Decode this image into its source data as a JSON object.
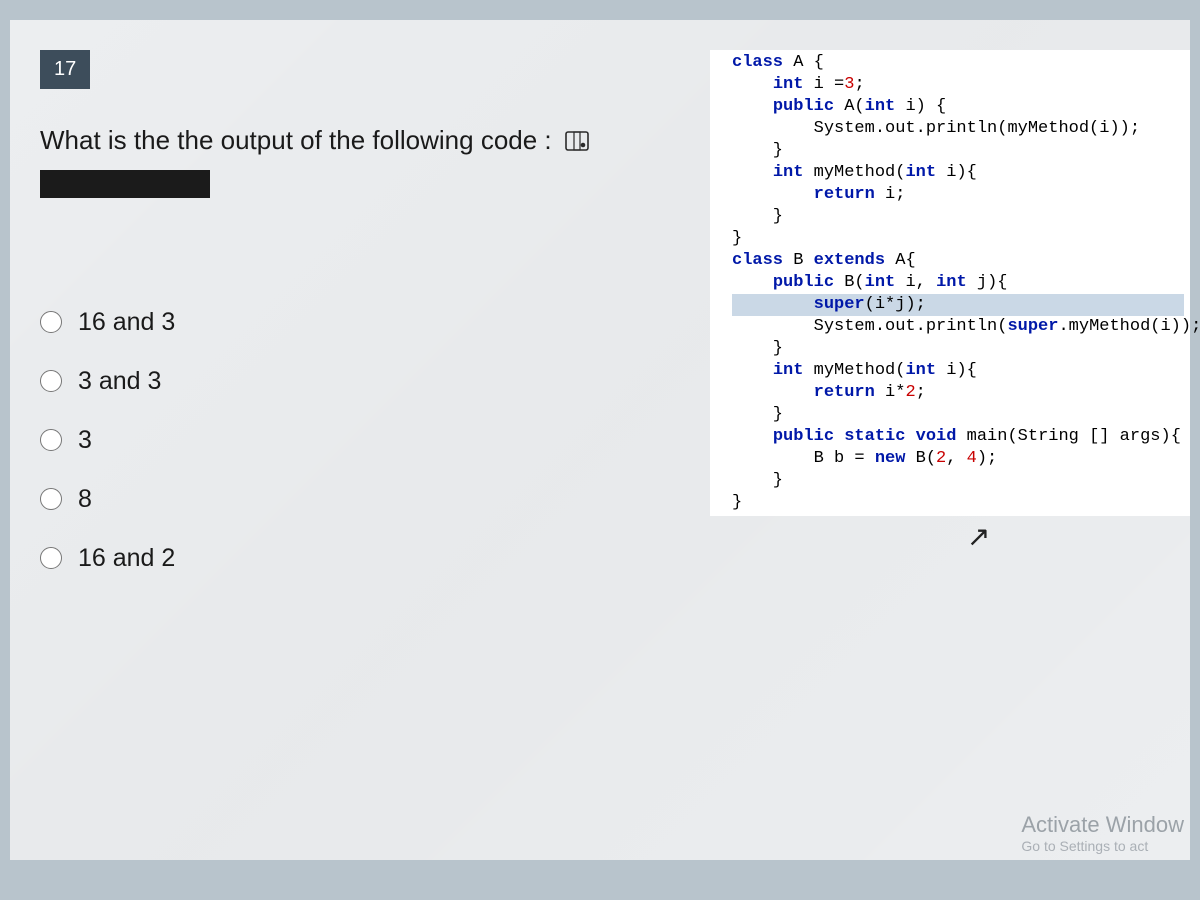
{
  "question": {
    "number": "17",
    "text": "What is the the output of the following code :"
  },
  "code": {
    "lines": [
      {
        "tokens": [
          {
            "t": "class ",
            "c": "kw"
          },
          {
            "t": "A {"
          }
        ]
      },
      {
        "tokens": [
          {
            "t": "    "
          },
          {
            "t": "int ",
            "c": "kw"
          },
          {
            "t": "i ="
          },
          {
            "t": "3",
            "c": "num"
          },
          {
            "t": ";"
          }
        ]
      },
      {
        "tokens": [
          {
            "t": "    "
          },
          {
            "t": "public ",
            "c": "kw"
          },
          {
            "t": "A("
          },
          {
            "t": "int ",
            "c": "kw"
          },
          {
            "t": "i) {"
          }
        ]
      },
      {
        "tokens": [
          {
            "t": "        System.out.println(myMethod(i));"
          }
        ]
      },
      {
        "tokens": [
          {
            "t": "    }"
          }
        ]
      },
      {
        "tokens": [
          {
            "t": "    "
          },
          {
            "t": "int ",
            "c": "kw"
          },
          {
            "t": "myMethod("
          },
          {
            "t": "int ",
            "c": "kw"
          },
          {
            "t": "i){"
          }
        ]
      },
      {
        "tokens": [
          {
            "t": "        "
          },
          {
            "t": "return ",
            "c": "kw"
          },
          {
            "t": "i;"
          }
        ]
      },
      {
        "tokens": [
          {
            "t": "    }"
          }
        ]
      },
      {
        "tokens": [
          {
            "t": "}"
          }
        ]
      },
      {
        "tokens": [
          {
            "t": "class ",
            "c": "kw"
          },
          {
            "t": "B "
          },
          {
            "t": "extends ",
            "c": "kw"
          },
          {
            "t": "A{"
          }
        ]
      },
      {
        "tokens": [
          {
            "t": "    "
          },
          {
            "t": "public ",
            "c": "kw"
          },
          {
            "t": "B("
          },
          {
            "t": "int ",
            "c": "kw"
          },
          {
            "t": "i, "
          },
          {
            "t": "int ",
            "c": "kw"
          },
          {
            "t": "j){"
          }
        ]
      },
      {
        "hl": true,
        "tokens": [
          {
            "t": "        "
          },
          {
            "t": "super",
            "c": "kw"
          },
          {
            "t": "(i*j);"
          }
        ]
      },
      {
        "tokens": [
          {
            "t": "        System.out.println("
          },
          {
            "t": "super",
            "c": "kw"
          },
          {
            "t": ".myMethod(i));"
          }
        ]
      },
      {
        "tokens": [
          {
            "t": "    }"
          }
        ]
      },
      {
        "tokens": [
          {
            "t": "    "
          },
          {
            "t": "int ",
            "c": "kw"
          },
          {
            "t": "myMethod("
          },
          {
            "t": "int ",
            "c": "kw"
          },
          {
            "t": "i){"
          }
        ]
      },
      {
        "tokens": [
          {
            "t": "        "
          },
          {
            "t": "return ",
            "c": "kw"
          },
          {
            "t": "i*"
          },
          {
            "t": "2",
            "c": "num"
          },
          {
            "t": ";"
          }
        ]
      },
      {
        "tokens": [
          {
            "t": "    }"
          }
        ]
      },
      {
        "tokens": [
          {
            "t": "    "
          },
          {
            "t": "public static void ",
            "c": "kw"
          },
          {
            "t": "main(String [] args){"
          }
        ]
      },
      {
        "tokens": [
          {
            "t": "        B b = "
          },
          {
            "t": "new ",
            "c": "kw"
          },
          {
            "t": "B("
          },
          {
            "t": "2",
            "c": "num"
          },
          {
            "t": ", "
          },
          {
            "t": "4",
            "c": "num"
          },
          {
            "t": ");"
          }
        ]
      },
      {
        "tokens": [
          {
            "t": "    }"
          }
        ]
      },
      {
        "tokens": [
          {
            "t": "}"
          }
        ]
      }
    ]
  },
  "options": [
    "16 and 3",
    "3 and 3",
    "3",
    "8",
    "16 and 2"
  ],
  "watermark": {
    "title": "Activate Window",
    "sub": "Go to Settings to act"
  }
}
